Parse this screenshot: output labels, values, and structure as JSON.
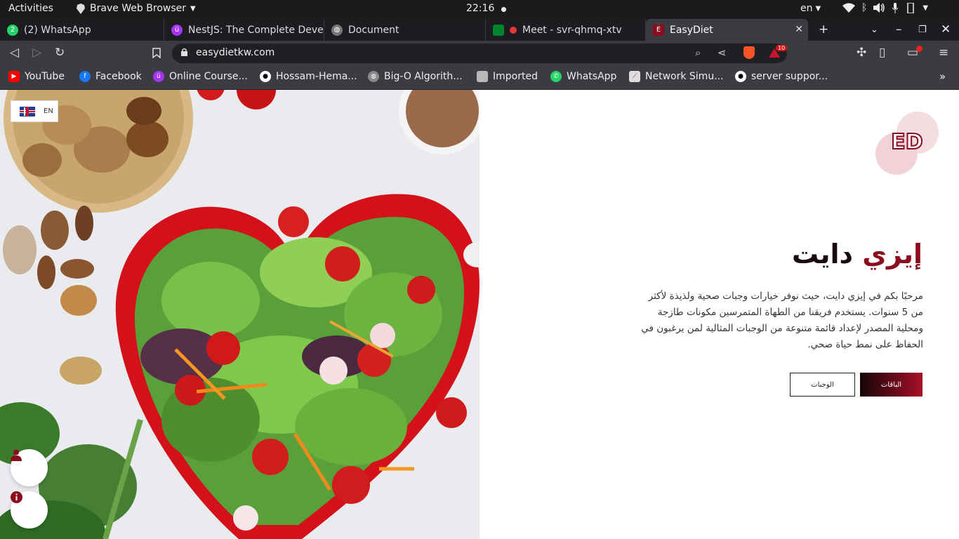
{
  "system_bar": {
    "activities": "Activities",
    "app_name": "Brave Web Browser",
    "time": "22:16",
    "lang": "en"
  },
  "tabs": [
    {
      "title": "(2) WhatsApp",
      "badge": "2"
    },
    {
      "title": "NestJS: The Complete Devel"
    },
    {
      "title": "Document"
    },
    {
      "title": "Meet - svr-qhmq-xtv"
    },
    {
      "title": "EasyDiet",
      "active": true
    }
  ],
  "address_bar": {
    "url": "easydietkw.com",
    "rewards_badge": "10"
  },
  "bookmarks": [
    {
      "label": "YouTube",
      "icon": "youtube-icon",
      "color": "#ff0000"
    },
    {
      "label": "Facebook",
      "icon": "facebook-icon",
      "color": "#1877f2"
    },
    {
      "label": "Online Course...",
      "icon": "udemy-icon",
      "color": "#a435f0"
    },
    {
      "label": "Hossam-Hema...",
      "icon": "github-icon",
      "color": "#ffffff"
    },
    {
      "label": "Big-O Algorith...",
      "icon": "globe-icon",
      "color": "#cccccc"
    },
    {
      "label": "Imported",
      "icon": "folder-icon",
      "color": "#b8b8b8"
    },
    {
      "label": "WhatsApp",
      "icon": "whatsapp-icon",
      "color": "#25d366"
    },
    {
      "label": "Network Simu...",
      "icon": "network-icon",
      "color": "#dddddd"
    },
    {
      "label": "server suppor...",
      "icon": "github-icon",
      "color": "#ffffff"
    }
  ],
  "page": {
    "lang_switch": "EN",
    "logo_text": "ED",
    "title_part1": "إيزي",
    "title_part2": "دايت",
    "description": "مرحبًا بكم في إيزي دايت، حيث نوفر خيارات وجبات صحية ولذيذة لأكثر من 5 سنوات. يستخدم فريقنا من الطهاة المتمرسين مكونات طازجة ومحلية المصدر لإعداد قائمة متنوعة من الوجبات المثالية لمن يرغبون في الحفاظ على نمط حياة صحي.",
    "btn_packages": "الباقات",
    "btn_meals": "الوجبات",
    "brand_color": "#8b0b1f"
  }
}
